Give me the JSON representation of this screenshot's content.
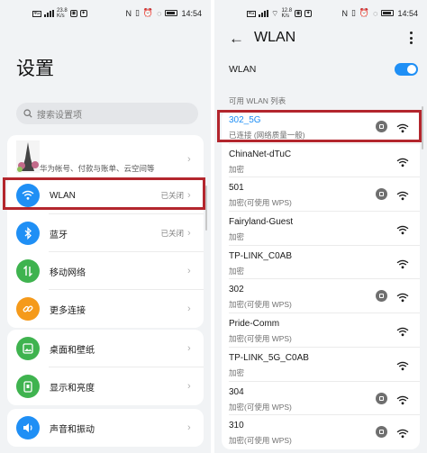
{
  "left": {
    "status": {
      "carrier_badge": "4G",
      "speed": "23.8",
      "speed_unit": "K/s",
      "time": "14:54"
    },
    "title": "设置",
    "search": {
      "placeholder": "搜索设置项"
    },
    "account": {
      "subtitle": "华为帐号、付款与账单、云空间等"
    },
    "rows": [
      {
        "label": "WLAN",
        "value": "已关闭",
        "icon": "wifi-icon",
        "color": "#1f8ff5"
      },
      {
        "label": "蓝牙",
        "value": "已关闭",
        "icon": "bluetooth-icon",
        "color": "#1f8ff5"
      },
      {
        "label": "移动网络",
        "value": "",
        "icon": "mobile-network-icon",
        "color": "#3fb34f"
      },
      {
        "label": "更多连接",
        "value": "",
        "icon": "link-icon",
        "color": "#f59a1b"
      },
      {
        "label": "桌面和壁纸",
        "value": "",
        "icon": "wallpaper-icon",
        "color": "#3fb34f"
      },
      {
        "label": "显示和亮度",
        "value": "",
        "icon": "display-icon",
        "color": "#3fb34f"
      },
      {
        "label": "声音和振动",
        "value": "",
        "icon": "sound-icon",
        "color": "#1f8ff5"
      }
    ]
  },
  "right": {
    "status": {
      "carrier_badge": "4G",
      "speed": "12.8",
      "speed_unit": "K/s",
      "time": "14:54"
    },
    "title": "WLAN",
    "toggle_label": "WLAN",
    "section": "可用 WLAN 列表",
    "networks": [
      {
        "name": "302_5G",
        "status": "已连接 (网络质量一般)",
        "locked": true,
        "active": true
      },
      {
        "name": "ChinaNet-dTuC",
        "status": "加密",
        "locked": false,
        "active": false
      },
      {
        "name": "501",
        "status": "加密(可使用 WPS)",
        "locked": true,
        "active": false
      },
      {
        "name": "Fairyland-Guest",
        "status": "加密",
        "locked": false,
        "active": false
      },
      {
        "name": "TP-LINK_C0AB",
        "status": "加密",
        "locked": false,
        "active": false
      },
      {
        "name": "302",
        "status": "加密(可使用 WPS)",
        "locked": true,
        "active": false
      },
      {
        "name": "Pride-Comm",
        "status": "加密(可使用 WPS)",
        "locked": false,
        "active": false
      },
      {
        "name": "TP-LINK_5G_C0AB",
        "status": "加密",
        "locked": false,
        "active": false
      },
      {
        "name": "304",
        "status": "加密(可使用 WPS)",
        "locked": true,
        "active": false
      },
      {
        "name": "310",
        "status": "加密(可使用 WPS)",
        "locked": true,
        "active": false
      }
    ]
  },
  "highlight_color": "#b3262d"
}
